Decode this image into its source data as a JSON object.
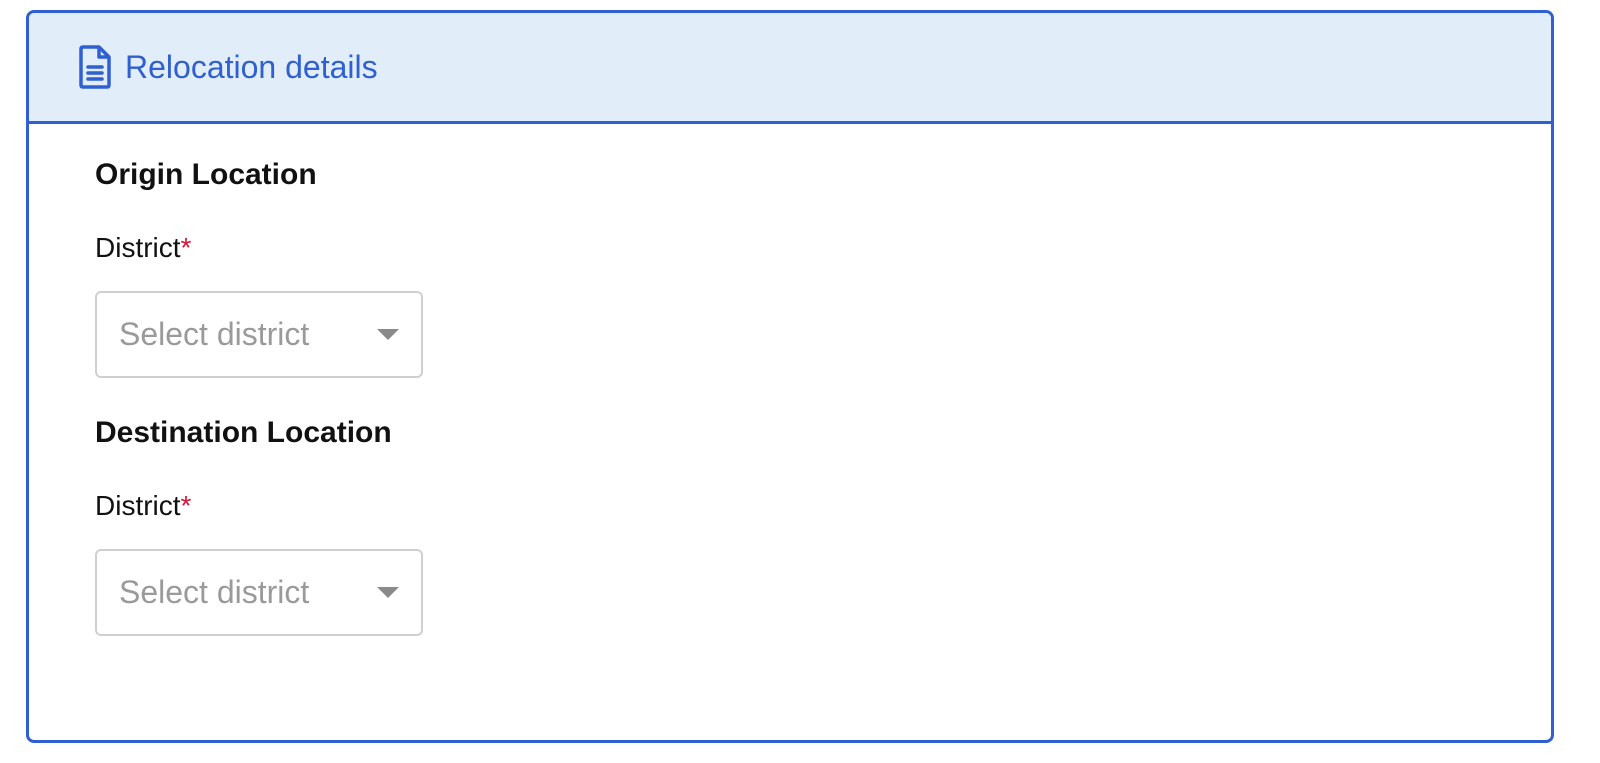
{
  "card": {
    "title": "Relocation details",
    "icon": "document-icon"
  },
  "origin": {
    "section_title": "Origin Location",
    "district_label": "District",
    "required_mark": "*",
    "district_placeholder": "Select district"
  },
  "destination": {
    "section_title": "Destination Location",
    "district_label": "District",
    "required_mark": "*",
    "district_placeholder": "Select district"
  },
  "colors": {
    "accent": "#2f5fd0",
    "header_bg": "#e1edf9",
    "required": "#d2163d",
    "placeholder": "#9a9a9a"
  }
}
